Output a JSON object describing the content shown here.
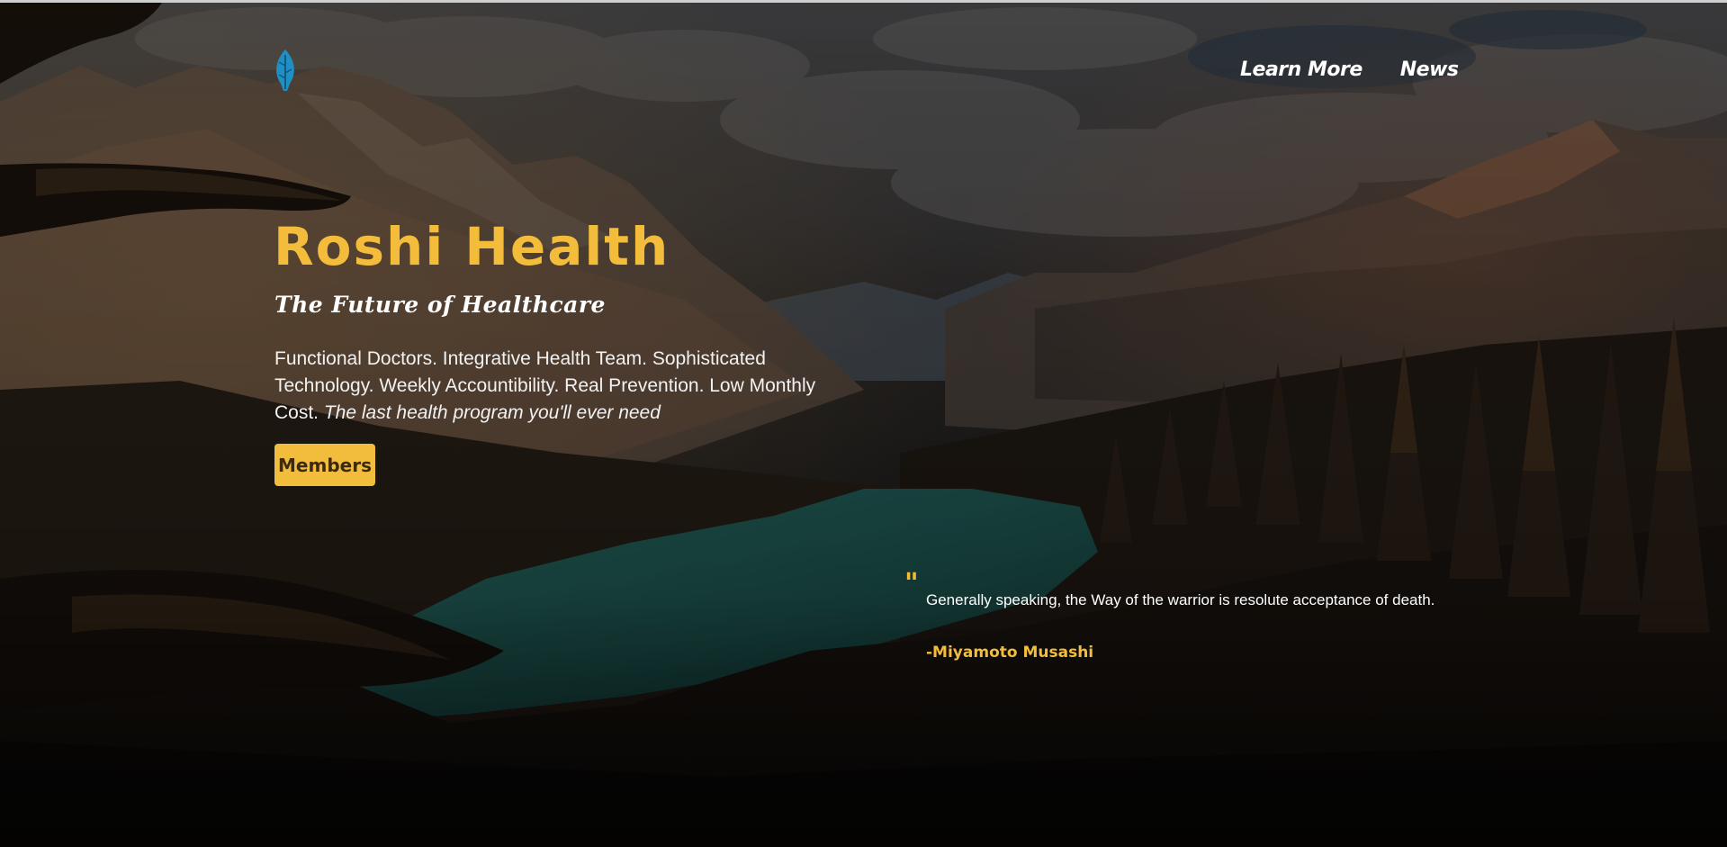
{
  "brand": {
    "logo_icon": "leaf-logo-icon",
    "accent_color": "#f2bc3d",
    "logo_color": "#1f8fc4"
  },
  "nav": {
    "items": [
      {
        "label": "Learn More"
      },
      {
        "label": "News"
      }
    ]
  },
  "hero": {
    "title": "Roshi Health",
    "subtitle": "The Future of Healthcare",
    "description": "Functional Doctors. Integrative Health Team. Sophisticated Technology. Weekly Accountibility. Real Prevention. Low Monthly Cost.",
    "description_emphasis": "The last health program you'll ever need",
    "cta_label": "Members"
  },
  "quote": {
    "mark": "\"",
    "text": "Generally speaking, the Way of the warrior is resolute acceptance of death.",
    "author": "-Miyamoto Musashi"
  }
}
